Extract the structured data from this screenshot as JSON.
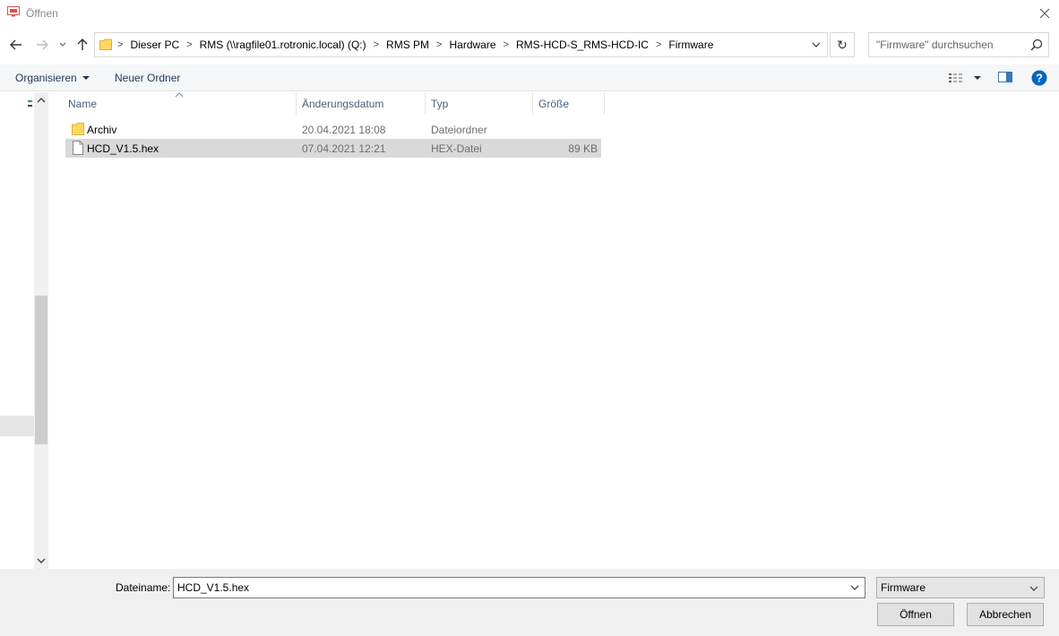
{
  "window": {
    "title": "Öffnen"
  },
  "address": {
    "crumbs": [
      "Dieser PC",
      "RMS (\\\\ragfile01.rotronic.local) (Q:)",
      "RMS PM",
      "Hardware",
      "RMS-HCD-S_RMS-HCD-IC",
      "Firmware"
    ]
  },
  "search": {
    "placeholder": "\"Firmware\" durchsuchen"
  },
  "toolbar": {
    "organize_label": "Organisieren",
    "new_folder_label": "Neuer Ordner"
  },
  "columns": {
    "name": "Name",
    "date": "Änderungsdatum",
    "type": "Typ",
    "size": "Größe"
  },
  "files": [
    {
      "name": "Archiv",
      "date": "20.04.2021 18:08",
      "type": "Dateiordner",
      "size": "",
      "icon": "folder-icon"
    },
    {
      "name": "HCD_V1.5.hex",
      "date": "07.04.2021 12:21",
      "type": "HEX-Datei",
      "size": "89 KB",
      "icon": "file-icon"
    }
  ],
  "bottom": {
    "filename_label": "Dateiname:",
    "filename_value": "HCD_V1.5.hex",
    "filter_value": "Firmware",
    "open_label": "Öffnen",
    "cancel_label": "Abbrechen"
  },
  "colors": {
    "accent": "#0067c0",
    "folder": "#ffd75e",
    "selection": "#d9d9d9"
  }
}
